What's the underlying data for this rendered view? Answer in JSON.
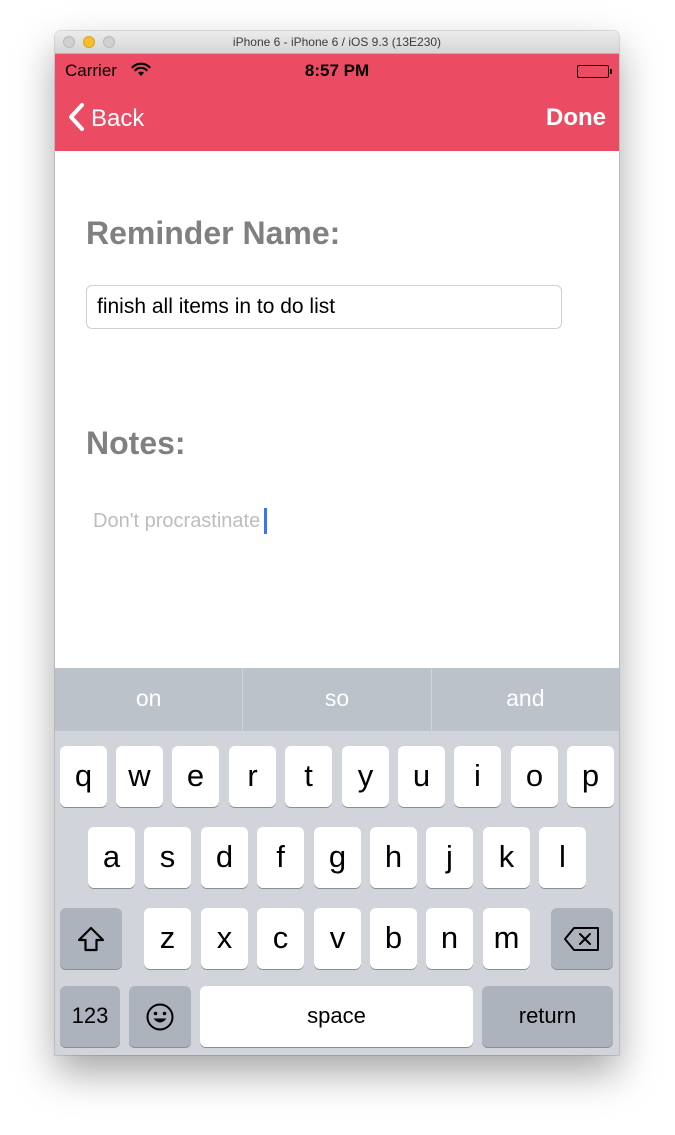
{
  "window": {
    "title": "iPhone 6 - iPhone 6 / iOS 9.3 (13E230)"
  },
  "status_bar": {
    "carrier": "Carrier",
    "time": "8:57 PM"
  },
  "nav": {
    "back_label": "Back",
    "done_label": "Done",
    "color": "#ec4b64"
  },
  "form": {
    "name_label": "Reminder Name:",
    "name_value": "finish all items in to do list",
    "notes_label": "Notes:",
    "notes_placeholder": "Don't procrastinate"
  },
  "keyboard": {
    "suggestions": [
      "on",
      "so",
      "and"
    ],
    "row1": [
      "q",
      "w",
      "e",
      "r",
      "t",
      "y",
      "u",
      "i",
      "o",
      "p"
    ],
    "row2": [
      "a",
      "s",
      "d",
      "f",
      "g",
      "h",
      "j",
      "k",
      "l"
    ],
    "row3": [
      "z",
      "x",
      "c",
      "v",
      "b",
      "n",
      "m"
    ],
    "numbers_label": "123",
    "space_label": "space",
    "return_label": "return",
    "shift_icon": "shift-icon",
    "backspace_icon": "backspace-icon",
    "emoji_icon": "emoji-icon"
  }
}
